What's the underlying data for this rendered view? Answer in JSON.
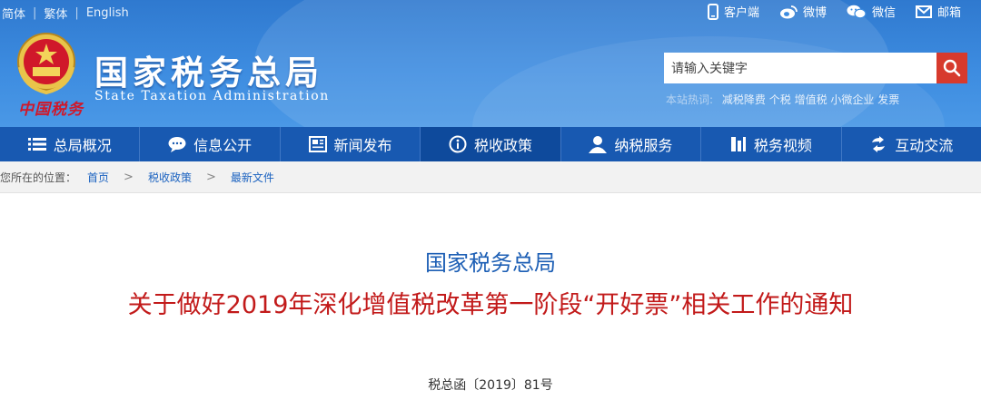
{
  "lang": {
    "simplified": "简体",
    "traditional": "繁体",
    "english": "English"
  },
  "top_links": [
    {
      "label": "客户端",
      "icon": "mobile-icon"
    },
    {
      "label": "微博",
      "icon": "weibo-icon"
    },
    {
      "label": "微信",
      "icon": "wechat-icon"
    },
    {
      "label": "邮箱",
      "icon": "mail-icon"
    }
  ],
  "site": {
    "title_cn": "国家税务总局",
    "title_en": "State Taxation Administration",
    "motto": "中国税务"
  },
  "search": {
    "placeholder": "请输入关键字",
    "hot_label": "本站热词:",
    "hot_words": [
      "减税降费",
      "个税",
      "增值税",
      "小微企业",
      "发票"
    ]
  },
  "nav": [
    {
      "label": "总局概况",
      "icon": "menu-icon"
    },
    {
      "label": "信息公开",
      "icon": "chat-bubble-icon"
    },
    {
      "label": "新闻发布",
      "icon": "newspaper-icon"
    },
    {
      "label": "税收政策",
      "icon": "info-icon",
      "active": true
    },
    {
      "label": "纳税服务",
      "icon": "user-icon"
    },
    {
      "label": "税务视频",
      "icon": "video-bars-icon"
    },
    {
      "label": "互动交流",
      "icon": "exchange-icon"
    }
  ],
  "breadcrumb": {
    "prefix": "您所在的位置：",
    "items": [
      "首页",
      "税收政策",
      "最新文件"
    ]
  },
  "article": {
    "org": "国家税务总局",
    "title": "关于做好2019年深化增值税改革第一阶段“开好票”相关工作的通知",
    "doc_number": "税总函〔2019〕81号"
  },
  "colors": {
    "header_blue": "#3d8ce0",
    "nav_blue": "#1859b1",
    "search_red": "#d73a2d",
    "title_red": "#c21a1a",
    "org_blue": "#1d5fb5"
  }
}
